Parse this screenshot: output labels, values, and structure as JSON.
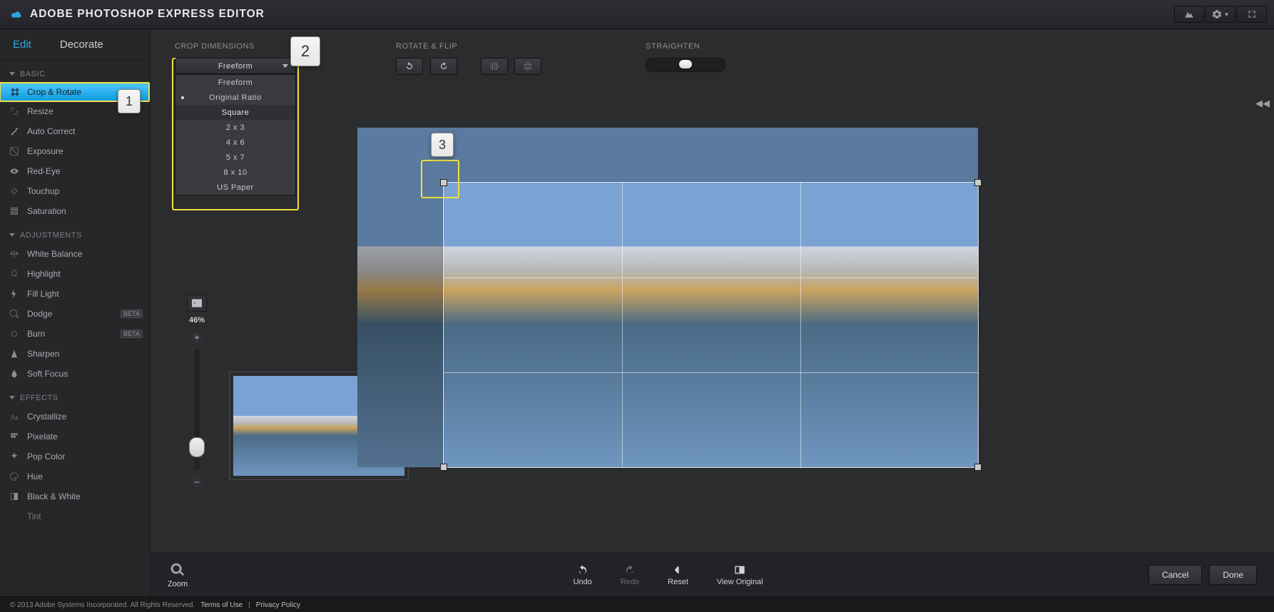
{
  "app_title": "ADOBE PHOTOSHOP EXPRESS EDITOR",
  "tabs": {
    "edit": "Edit",
    "decorate": "Decorate"
  },
  "callouts": {
    "one": "1",
    "two": "2",
    "three": "3"
  },
  "sections": {
    "basic": {
      "title": "BASIC",
      "items": [
        "Crop & Rotate",
        "Resize",
        "Auto Correct",
        "Exposure",
        "Red-Eye",
        "Touchup",
        "Saturation"
      ]
    },
    "adjustments": {
      "title": "ADJUSTMENTS",
      "items": [
        "White Balance",
        "Highlight",
        "Fill Light",
        "Dodge",
        "Burn",
        "Sharpen",
        "Soft Focus"
      ]
    },
    "effects": {
      "title": "EFFECTS",
      "items": [
        "Crystallize",
        "Pixelate",
        "Pop Color",
        "Hue",
        "Black & White",
        "Tint"
      ]
    }
  },
  "beta_label": "BETA",
  "controls": {
    "crop_dim_label": "CROP DIMENSIONS",
    "rotate_label": "ROTATE & FLIP",
    "straighten_label": "STRAIGHTEN",
    "dropdown_selected": "Freeform",
    "dropdown_items": [
      "Freeform",
      "Original Ratio",
      "Square",
      "2 x 3",
      "4 x 6",
      "5 x 7",
      "8 x 10",
      "US Paper"
    ]
  },
  "zoom": {
    "pct": "46%",
    "plus": "+",
    "minus": "–",
    "label": "Zoom"
  },
  "bottom": {
    "undo": "Undo",
    "redo": "Redo",
    "reset": "Reset",
    "view_original": "View Original"
  },
  "buttons": {
    "cancel": "Cancel",
    "done": "Done"
  },
  "status": {
    "copyright": "© 2013 Adobe Systems Incorporated. All Rights Reserved.",
    "terms": "Terms of Use",
    "sep": "|",
    "privacy": "Privacy Policy"
  }
}
